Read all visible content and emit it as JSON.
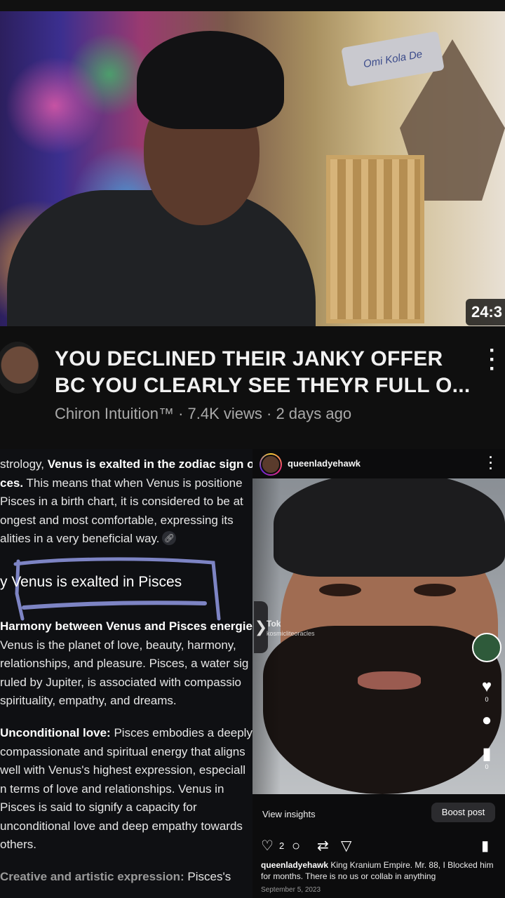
{
  "video": {
    "duration": "24:3",
    "sign_text": "Omi Kola De",
    "title_line1": "YOU DECLINED THEIR JANKY OFFER",
    "title_line2": "BC YOU CLEARLY SEE THEYR FULL O...",
    "meta": "Chiron Intuition™ · 7.4K views · 2 days ago"
  },
  "article": {
    "p1": {
      "l1_pre": "strology, ",
      "l1_bold": "Venus is exalted in the zodiac sign o",
      "l2_bold": "ces.",
      "l2_rest": " This means that when Venus is positione",
      "l3": "Pisces in a birth chart, it is considered to be at",
      "l4": "ongest and most comfortable, expressing its",
      "l5": "alities in a very beneficial way."
    },
    "heading": "y Venus is exalted in Pisces",
    "p2": {
      "bold": "Harmony between Venus and Pisces energies",
      "l2": "Venus is the planet of love, beauty, harmony,",
      "l3": "relationships, and pleasure. Pisces, a water sig",
      "l4": "ruled by Jupiter, is associated with compassio",
      "l5": "spirituality, empathy, and dreams."
    },
    "p3": {
      "bold": "Unconditional love:",
      "l1_rest": " Pisces embodies a deeply",
      "l2": "compassionate and spiritual energy that aligns",
      "l3": "well with Venus's highest expression, especiall",
      "l4": "n terms of love and relationships. Venus in",
      "l5": "Pisces is said to signify a capacity for",
      "l6": "unconditional love and deep empathy towards",
      "l7": "others."
    },
    "p4": {
      "bold": "Creative and artistic expression:",
      "rest": " Pisces's"
    }
  },
  "instagram": {
    "username": "queenladyehawk",
    "tiktok_label": "Tok",
    "tiktok_handle": "kosmicliteoracles",
    "like_count_side": "0",
    "bookmark_count_side": "0",
    "view_insights": "View insights",
    "boost_post": "Boost post",
    "like_count": "2",
    "caption_user": "queenladyehawk",
    "caption_text": " King Kranium Empire. Mr. 88, I Blocked him for months. There is no us or collab in anything",
    "date": "September 5, 2023"
  },
  "icons": [
    "more-vertical-icon",
    "link-icon",
    "heart-icon",
    "comment-icon",
    "repost-icon",
    "share-icon",
    "bookmark-icon",
    "chevron-right-icon"
  ],
  "colors": {
    "background": "#0f0f0f",
    "meta_gray": "#aaaaaa",
    "scribble": "#7d84c4"
  }
}
